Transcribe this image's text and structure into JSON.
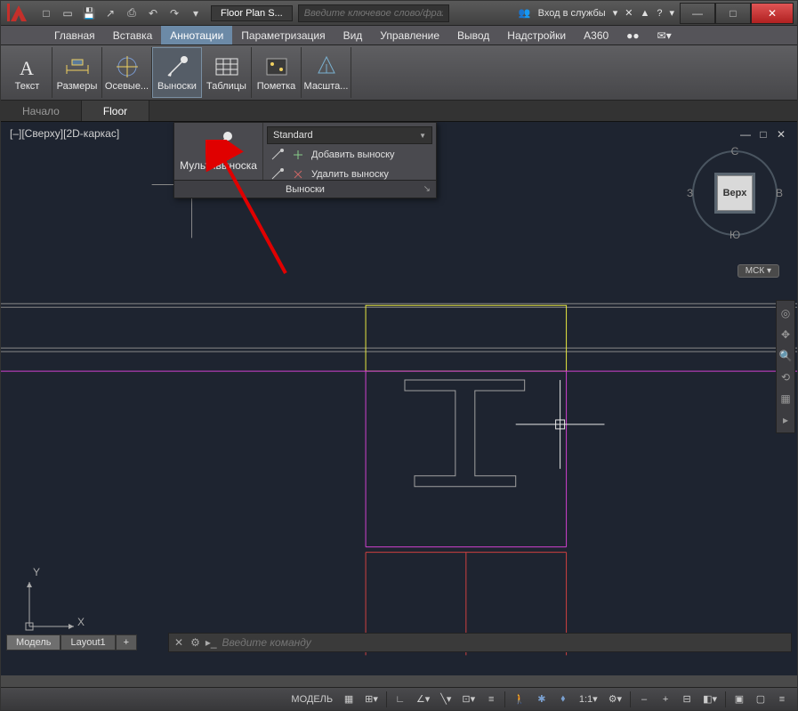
{
  "titlebar": {
    "doc_title": "Floor Plan S...",
    "search_placeholder": "Введите ключевое слово/фразу",
    "login_label": "Вход в службы",
    "help_glyph": "?"
  },
  "menu": {
    "items": [
      "Главная",
      "Вставка",
      "Аннотации",
      "Параметризация",
      "Вид",
      "Управление",
      "Вывод",
      "Надстройки",
      "A360"
    ],
    "active_index": 2
  },
  "ribbon": {
    "buttons": [
      {
        "label": "Текст"
      },
      {
        "label": "Размеры"
      },
      {
        "label": "Осевые..."
      },
      {
        "label": "Выноски"
      },
      {
        "label": "Таблицы"
      },
      {
        "label": "Пометка"
      },
      {
        "label": "Масшта..."
      }
    ],
    "active_index": 3
  },
  "file_tabs": {
    "start": "Начало",
    "active": "Floor"
  },
  "view_label": "[–][Сверху][2D-каркас]",
  "viewcube": {
    "top": "Верх",
    "n": "С",
    "s": "Ю",
    "e": "В",
    "w": "З"
  },
  "wcs": "МСК",
  "dropdown": {
    "multileader": "Мультивыноска",
    "style": "Standard",
    "add": "Добавить выноску",
    "remove": "Удалить выноску",
    "footer": "Выноски"
  },
  "ucs": {
    "x": "X",
    "y": "Y"
  },
  "cmd": {
    "placeholder": "Введите команду"
  },
  "layout_tabs": {
    "model": "Модель",
    "layout": "Layout1",
    "plus": "+"
  },
  "statusbar": {
    "model": "МОДЕЛЬ",
    "scale": "1:1",
    "minus": "–",
    "plus": "+"
  }
}
